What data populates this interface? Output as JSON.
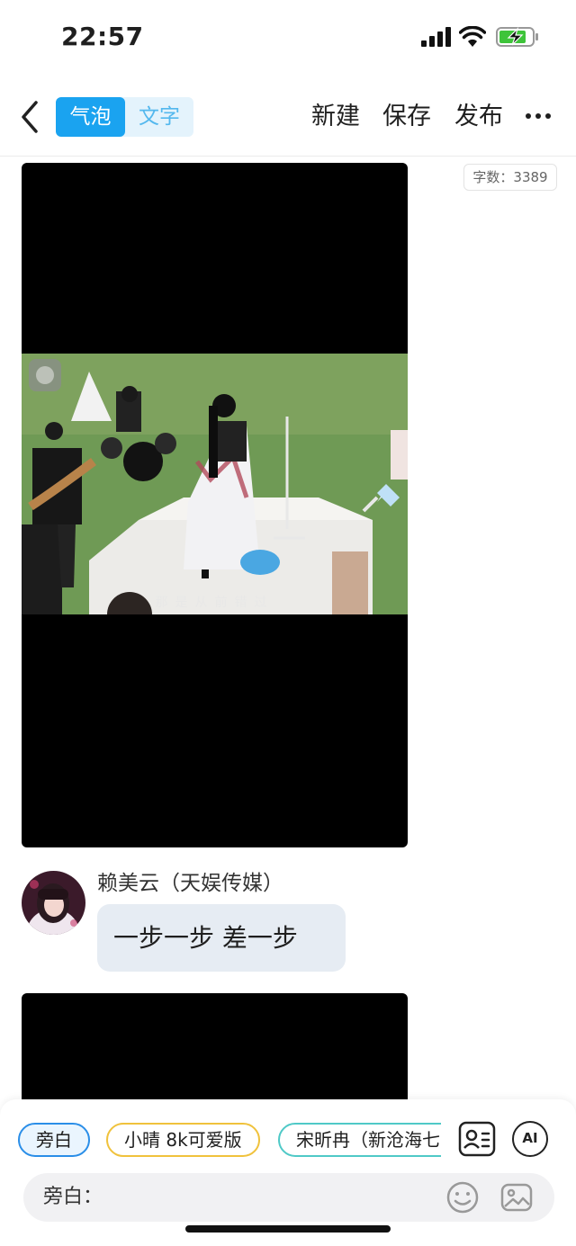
{
  "status_bar": {
    "time": "22:57",
    "icons": [
      "cellular-signal-icon",
      "wifi-icon",
      "battery-charging-icon"
    ]
  },
  "nav": {
    "back_icon": "chevron-left-icon",
    "mode_bubble": "气泡",
    "mode_text": "文字",
    "new": "新建",
    "save": "保存",
    "publish": "发布",
    "more_icon": "more-horizontal-icon"
  },
  "content": {
    "word_count": "字数：3389",
    "video_subtitle": "那是从前错过",
    "message": {
      "author": "赖美云（天娱传媒）",
      "text": "一步一步 差一步"
    }
  },
  "bottom": {
    "roles": [
      "旁白",
      "小晴 8k可爱版",
      "宋昕冉（新沧海七"
    ],
    "contact_icon": "contact-card-icon",
    "ai_label": "AI",
    "input_label": "旁白：",
    "input_value": "",
    "emoji_icon": "smile-icon",
    "image_icon": "image-icon"
  },
  "colors": {
    "accent": "#1aa3f0",
    "accent_light": "#e4f3fc",
    "bubble_bg": "#e6ecf3",
    "chip_narrator": "#2a8ee8",
    "chip_xiaoqing": "#f0c23c",
    "chip_songxinran": "#4fc9c7",
    "battery_green": "#3ec43a"
  }
}
